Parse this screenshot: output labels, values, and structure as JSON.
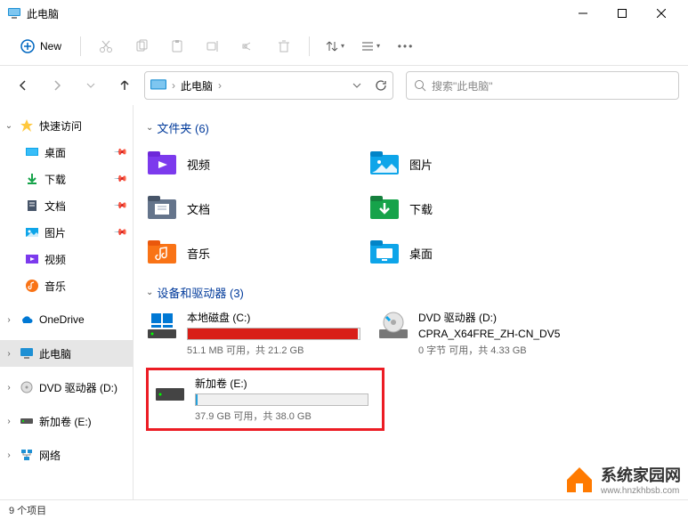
{
  "window": {
    "title": "此电脑"
  },
  "toolbar": {
    "new_label": "New"
  },
  "breadcrumb": {
    "root": "此电脑"
  },
  "search": {
    "placeholder": "搜索\"此电脑\""
  },
  "sidebar": {
    "quick": "快速访问",
    "desktop": "桌面",
    "downloads": "下载",
    "documents": "文档",
    "pictures": "图片",
    "videos": "视频",
    "music": "音乐",
    "onedrive": "OneDrive",
    "thispc": "此电脑",
    "dvd": "DVD 驱动器 (D:)",
    "newvol": "新加卷 (E:)",
    "network": "网络"
  },
  "sections": {
    "folders": "文件夹 (6)",
    "devices": "设备和驱动器 (3)"
  },
  "folders": {
    "videos": "视频",
    "pictures": "图片",
    "documents": "文档",
    "downloads": "下载",
    "music": "音乐",
    "desktop": "桌面"
  },
  "drives": {
    "c": {
      "name": "本地磁盘 (C:)",
      "sub": "51.1 MB 可用，共 21.2 GB",
      "fill_pct": 99,
      "fill_color": "#d91e18"
    },
    "d": {
      "name": "DVD 驱动器 (D:)",
      "name2": "CPRA_X64FRE_ZH-CN_DV5",
      "sub": "0 字节 可用，共 4.33 GB"
    },
    "e": {
      "name": "新加卷 (E:)",
      "sub": "37.9 GB 可用，共 38.0 GB",
      "fill_pct": 1,
      "fill_color": "#26a0da"
    }
  },
  "status": {
    "text": "9 个项目"
  },
  "watermark": {
    "text": "系统家园网",
    "url": "www.hnzkhbsb.com"
  }
}
